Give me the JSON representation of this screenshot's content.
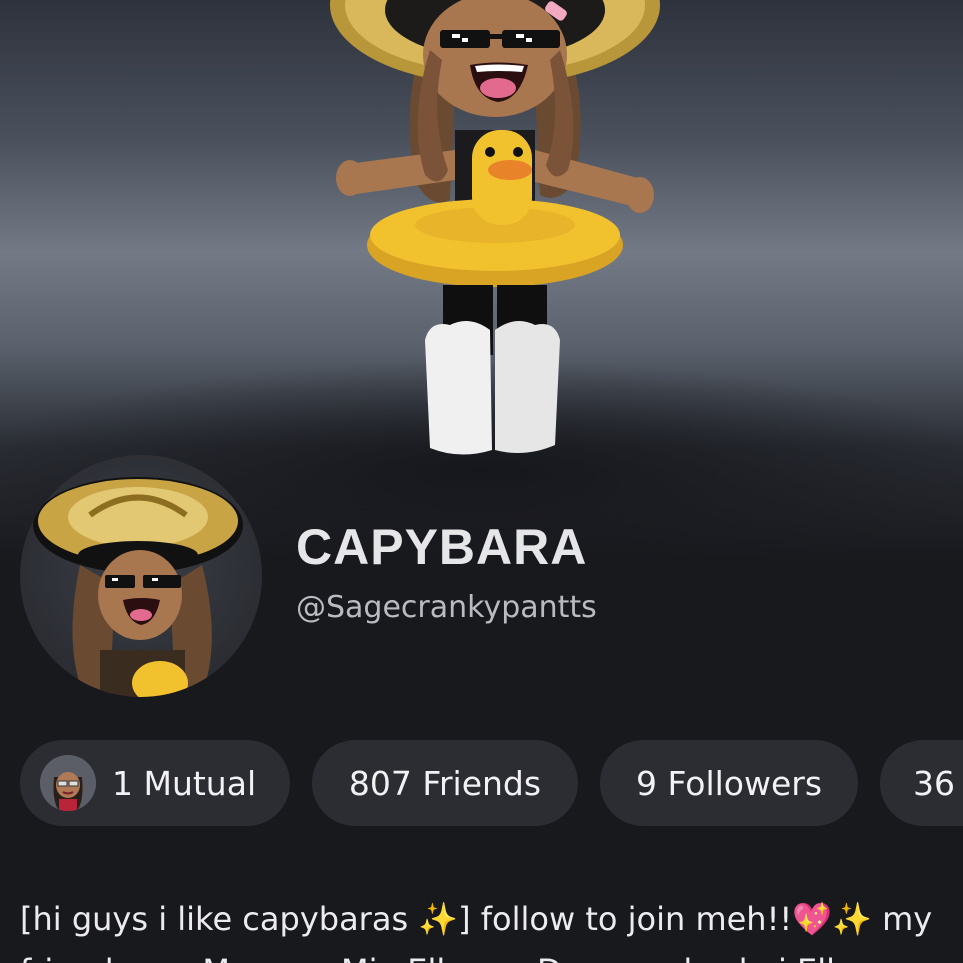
{
  "profile": {
    "display_name": "CAPYBARA",
    "username": "@Sagecrankypantts"
  },
  "stats": {
    "mutual": "1 Mutual",
    "friends": "807 Friends",
    "followers": "9 Followers",
    "following_partial": "36"
  },
  "bio": {
    "line1": "[hi guys i like capybaras ✨] follow to join meh!!💖✨ my",
    "line2": "friends are Mommy Mia Elly ara Dogg and sebxi Elly are"
  },
  "icons": {
    "hero_avatar": "avatar-3d-figure-icon",
    "profile_avatar": "profile-headshot-icon",
    "mutual_avatar": "mutual-friend-avatar-icon"
  },
  "colors": {
    "background": "#18191d",
    "chip": "#2b2d33",
    "duck_yellow": "#f2c12e"
  }
}
